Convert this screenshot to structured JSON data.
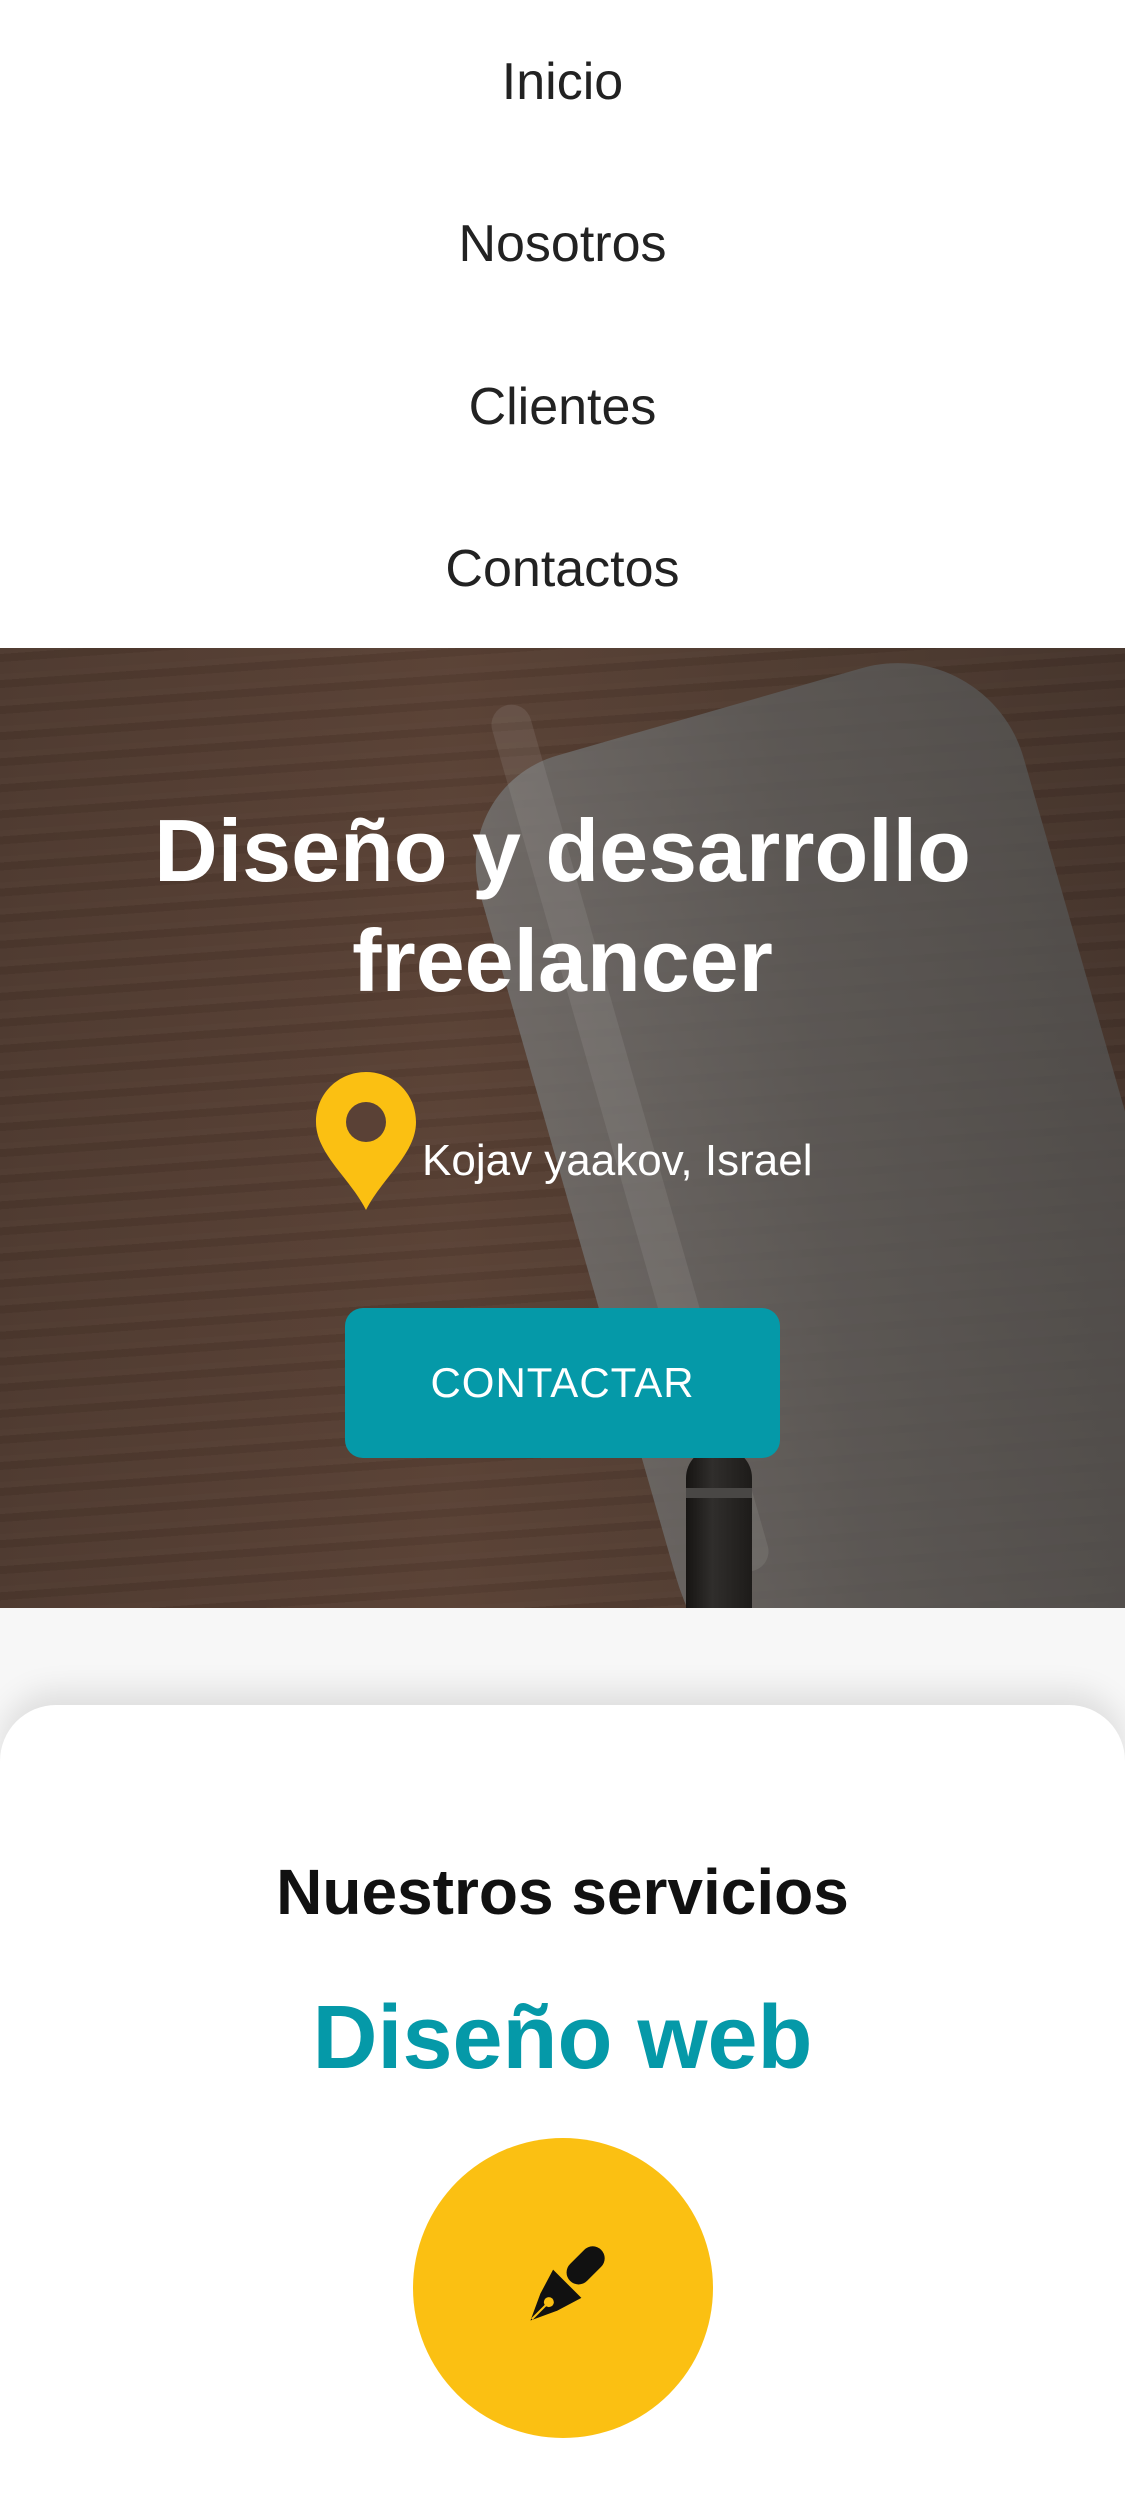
{
  "nav": {
    "items": [
      {
        "label": "Inicio"
      },
      {
        "label": "Nosotros"
      },
      {
        "label": "Clientes"
      },
      {
        "label": "Contactos"
      }
    ]
  },
  "hero": {
    "title": "Diseño y desarrollo freelancer",
    "location_icon": "map-pin-icon",
    "location": "Kojav yaakov, Israel",
    "cta_label": "CONTACTAR"
  },
  "services": {
    "heading": "Nuestros servicios",
    "items": [
      {
        "title": "Diseño web",
        "icon": "pen-nib-icon"
      }
    ]
  },
  "colors": {
    "accent": "#0599a8",
    "highlight": "#fbc012",
    "text": "#222222"
  }
}
